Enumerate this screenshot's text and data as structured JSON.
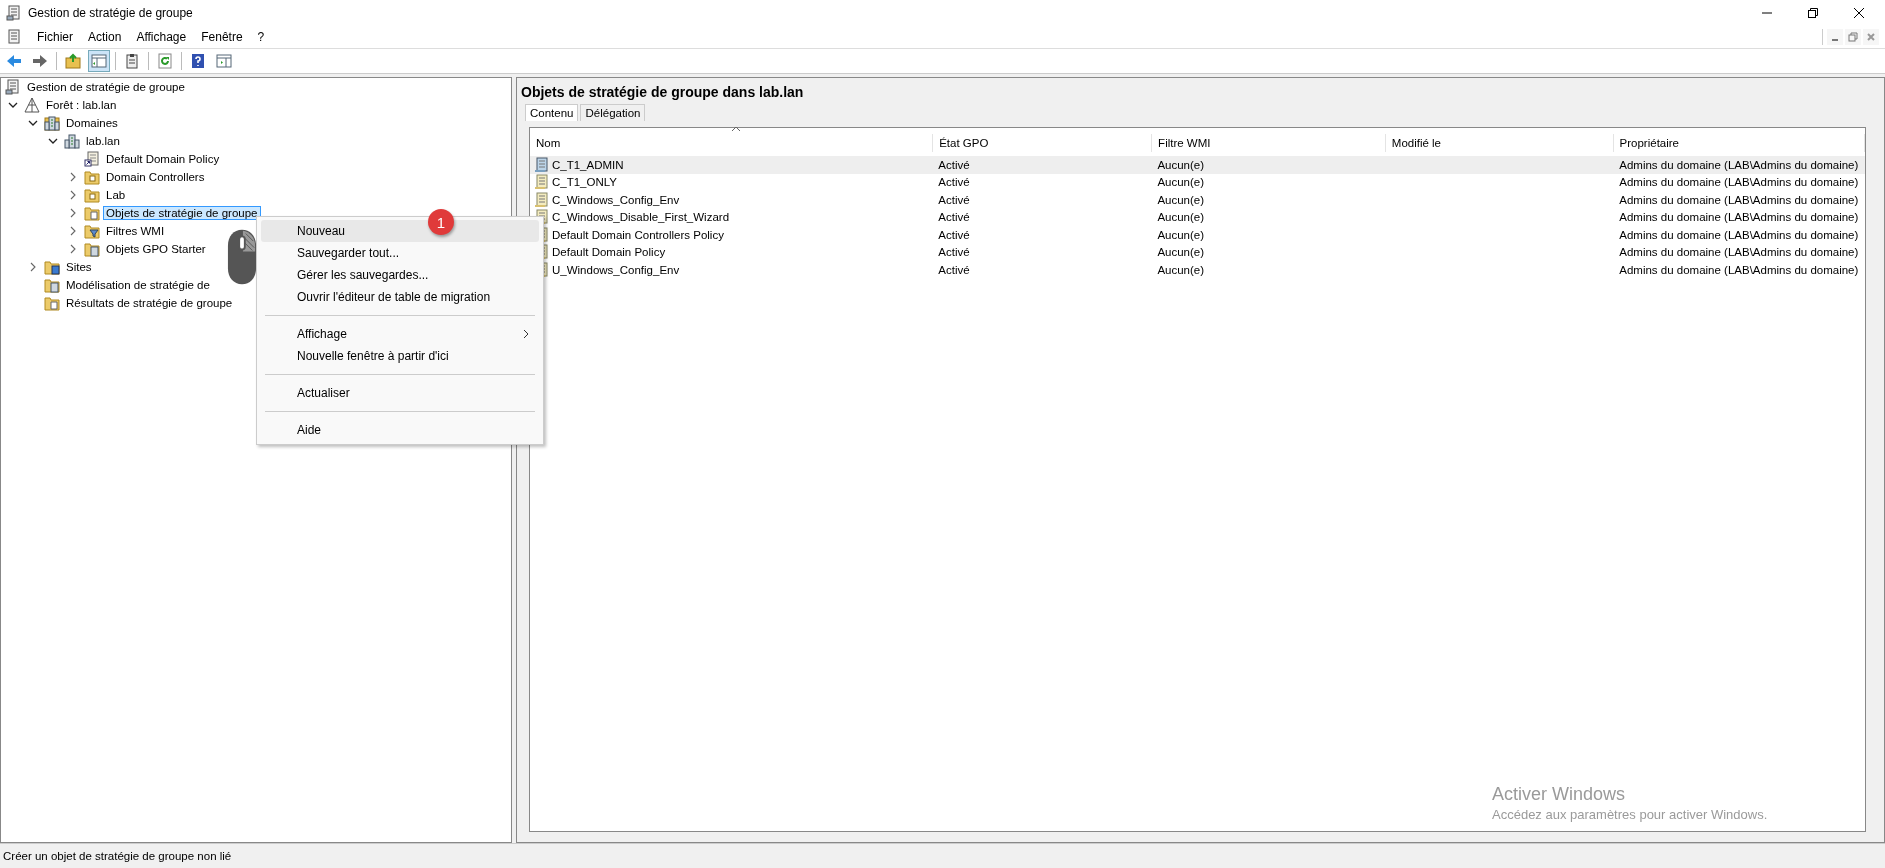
{
  "window": {
    "title": "Gestion de stratégie de groupe"
  },
  "menu": [
    "Fichier",
    "Action",
    "Affichage",
    "Fenêtre",
    "?"
  ],
  "toolbar": {
    "console_tree_shown": true
  },
  "tree": [
    {
      "label": "Gestion de stratégie de groupe",
      "kind": "console",
      "selected": false,
      "children": [
        {
          "label": "Forêt : lab.lan",
          "kind": "forest",
          "selected": false,
          "expanded": true,
          "children": [
            {
              "label": "Domaines",
              "kind": "domains",
              "selected": false,
              "expanded": true,
              "children": [
                {
                  "label": "lab.lan",
                  "kind": "domain",
                  "selected": false,
                  "expanded": true,
                  "children": [
                    {
                      "label": "Default Domain Policy",
                      "kind": "link",
                      "selected": false
                    },
                    {
                      "label": "Domain Controllers",
                      "kind": "ou",
                      "selected": false,
                      "expanded": false
                    },
                    {
                      "label": "Lab",
                      "kind": "ou",
                      "selected": false,
                      "expanded": false
                    },
                    {
                      "label": "Objets de stratégie de groupe",
                      "kind": "gpofolder",
                      "selected": true,
                      "expanded": false
                    },
                    {
                      "label": "Filtres WMI",
                      "kind": "filter",
                      "selected": false,
                      "expanded": false
                    },
                    {
                      "label": "Objets GPO Starter",
                      "kind": "starter",
                      "selected": false,
                      "expanded": false
                    }
                  ]
                }
              ]
            },
            {
              "label": "Sites",
              "kind": "sites",
              "selected": false,
              "expanded": false
            },
            {
              "label": "Modélisation de stratégie de",
              "kind": "modeling",
              "selected": false
            },
            {
              "label": "Résultats de stratégie de groupe",
              "kind": "results",
              "selected": false
            }
          ]
        }
      ]
    }
  ],
  "content": {
    "heading": "Objets de stratégie de groupe dans lab.lan",
    "tabs": [
      {
        "label": "Contenu",
        "selected": true
      },
      {
        "label": "Délégation",
        "selected": false
      }
    ],
    "table": {
      "columns": [
        {
          "label": "Nom",
          "sorted": true
        },
        {
          "label": "État GPO"
        },
        {
          "label": "Filtre WMI"
        },
        {
          "label": "Modifié le"
        },
        {
          "label": "Propriétaire"
        }
      ],
      "rows": [
        {
          "name": "C_T1_ADMIN",
          "state": "Activé",
          "wmi": "Aucun(e)",
          "owner": "Admins du domaine (LAB\\Admins du domaine)",
          "selected": true
        },
        {
          "name": "C_T1_ONLY",
          "state": "Activé",
          "wmi": "Aucun(e)",
          "owner": "Admins du domaine (LAB\\Admins du domaine)",
          "selected": false
        },
        {
          "name": "C_Windows_Config_Env",
          "state": "Activé",
          "wmi": "Aucun(e)",
          "owner": "Admins du domaine (LAB\\Admins du domaine)",
          "selected": false
        },
        {
          "name": "C_Windows_Disable_First_Wizard",
          "state": "Activé",
          "wmi": "Aucun(e)",
          "owner": "Admins du domaine (LAB\\Admins du domaine)",
          "selected": false
        },
        {
          "name": "Default Domain Controllers Policy",
          "state": "Activé",
          "wmi": "Aucun(e)",
          "owner": "Admins du domaine (LAB\\Admins du domaine)",
          "selected": false
        },
        {
          "name": "Default Domain Policy",
          "state": "Activé",
          "wmi": "Aucun(e)",
          "owner": "Admins du domaine (LAB\\Admins du domaine)",
          "selected": false
        },
        {
          "name": "U_Windows_Config_Env",
          "state": "Activé",
          "wmi": "Aucun(e)",
          "owner": "Admins du domaine (LAB\\Admins du domaine)",
          "selected": false
        }
      ]
    }
  },
  "context_menu": [
    {
      "kind": "item",
      "label": "Nouveau",
      "selected": true
    },
    {
      "kind": "item",
      "label": "Sauvegarder tout...",
      "selected": false
    },
    {
      "kind": "item",
      "label": "Gérer les sauvegardes...",
      "selected": false
    },
    {
      "kind": "item",
      "label": "Ouvrir l'éditeur de table de migration",
      "selected": false
    },
    {
      "kind": "separator"
    },
    {
      "kind": "submenu",
      "label": "Affichage",
      "selected": false
    },
    {
      "kind": "item",
      "label": "Nouvelle fenêtre à partir d'ici",
      "selected": false
    },
    {
      "kind": "separator"
    },
    {
      "kind": "item",
      "label": "Actualiser",
      "selected": false
    },
    {
      "kind": "separator"
    },
    {
      "kind": "item",
      "label": "Aide",
      "selected": false
    }
  ],
  "step_badge": "1",
  "activation_notice": {
    "title": "Activer Windows",
    "message": "Accédez aux paramètres pour activer Windows."
  },
  "status_bar": "Créer un objet de stratégie de groupe non lié"
}
